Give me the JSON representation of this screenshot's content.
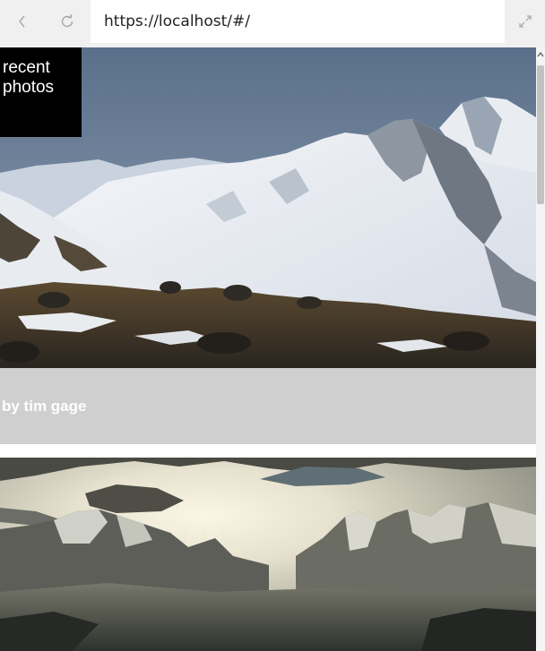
{
  "browser": {
    "back_icon": "chevron-left-icon",
    "refresh_icon": "refresh-icon",
    "expand_icon": "expand-icon",
    "url": "https://localhost/#/"
  },
  "page": {
    "header": "recent photos",
    "photos": [
      {
        "subject": "snowy mountain ridge",
        "caption": "by tim gage"
      },
      {
        "subject": "sunbeams over mountain range",
        "caption": ""
      }
    ]
  },
  "colors": {
    "header_bg": "#000000",
    "caption_bg": "#cfcfcf",
    "caption_text": "#ffffff",
    "toolbar_bg": "#f0f0f0"
  }
}
